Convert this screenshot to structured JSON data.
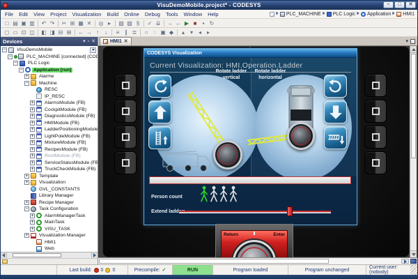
{
  "window": {
    "title": "VisuDemoMobile.project* - CODESYS",
    "controls": [
      {
        "glyph": "–",
        "name": "minimize"
      },
      {
        "glyph": "□",
        "name": "maximize"
      },
      {
        "glyph": "✕",
        "name": "close"
      }
    ]
  },
  "menu": {
    "items": [
      "File",
      "Edit",
      "View",
      "Project",
      "Visualization",
      "Build",
      "Online",
      "Debug",
      "Tools",
      "Window",
      "Help"
    ]
  },
  "breadcrumb": {
    "items": [
      {
        "label": "",
        "icon": "page"
      },
      {
        "label": "PLC_MACHINE",
        "icon": "device"
      },
      {
        "label": "PLC Logic",
        "icon": "plclogic"
      },
      {
        "label": "Application",
        "icon": "app"
      },
      {
        "label": "HMI1",
        "icon": "visu"
      }
    ]
  },
  "toolbars": {
    "row1": [
      {
        "g": "□",
        "n": "new-project"
      },
      {
        "g": "▤",
        "n": "open-project"
      },
      {
        "g": "▣",
        "n": "save-project"
      },
      {
        "g": "▥",
        "n": "print"
      },
      {
        "sep": true
      },
      {
        "g": "↶",
        "n": "undo"
      },
      {
        "g": "↷",
        "n": "redo"
      },
      {
        "sep": true
      },
      {
        "g": "✂",
        "n": "cut"
      },
      {
        "g": "⊞",
        "n": "copy"
      },
      {
        "g": "▦",
        "n": "paste"
      },
      {
        "g": "✕",
        "n": "delete"
      },
      {
        "sep": true
      },
      {
        "g": "◎",
        "n": "find"
      },
      {
        "g": "▸",
        "n": "find-next"
      },
      {
        "sep": true
      },
      {
        "g": "▧",
        "n": "new-pou"
      },
      {
        "g": "▨",
        "n": "new-device"
      },
      {
        "g": "§",
        "n": "edit-code"
      },
      {
        "sep": true
      },
      {
        "g": "✓",
        "n": "precompile"
      },
      {
        "g": "⇊",
        "n": "download"
      },
      {
        "sep": true
      },
      {
        "g": "→",
        "n": "login"
      },
      {
        "g": "←",
        "n": "logout"
      },
      {
        "g": "▶",
        "n": "start",
        "c": "#2e7d32"
      },
      {
        "g": "■",
        "n": "stop",
        "c": "#8a3a3a"
      },
      {
        "g": "▪",
        "n": "breakpoint"
      },
      {
        "g": "↻",
        "n": "reset"
      }
    ],
    "row2": [
      {
        "g": "◻",
        "n": "select-tool"
      },
      {
        "g": "▭",
        "n": "frame-tool"
      },
      {
        "g": "⊡",
        "n": "insert-element"
      },
      {
        "g": "◫",
        "n": "split-view"
      },
      {
        "sep": true
      },
      {
        "g": "◧",
        "n": "align-left"
      },
      {
        "g": "◨",
        "n": "align-right"
      },
      {
        "g": "⊟",
        "n": "align-top"
      },
      {
        "g": "⊞",
        "n": "align-bottom"
      },
      {
        "sep": true
      },
      {
        "g": "←",
        "n": "nudge-left"
      },
      {
        "g": "→",
        "n": "nudge-right"
      },
      {
        "g": "↑",
        "n": "nudge-up"
      },
      {
        "g": "↓",
        "n": "nudge-down"
      },
      {
        "sep": true
      },
      {
        "g": "≡",
        "n": "distribute"
      },
      {
        "g": "∥",
        "n": "same-width"
      },
      {
        "g": "≣",
        "n": "same-height"
      },
      {
        "sep": true
      },
      {
        "g": "○",
        "n": "ellipse-tool"
      },
      {
        "g": "◌",
        "n": "polygon-tool"
      },
      {
        "g": "▣",
        "n": "rectangle-tool"
      },
      {
        "g": "◆",
        "n": "rotate-tool"
      },
      {
        "sep": true
      },
      {
        "g": "▴",
        "n": "bring-forward"
      },
      {
        "g": "▾",
        "n": "send-backward"
      },
      {
        "g": "◂",
        "n": "group"
      },
      {
        "g": "▸",
        "n": "ungroup"
      }
    ]
  },
  "devices_panel": {
    "title": "Devices",
    "header_buttons": [
      {
        "glyph": "▾",
        "name": "panel-dropdown"
      },
      {
        "glyph": "▫",
        "name": "panel-pin"
      },
      {
        "glyph": "✕",
        "name": "panel-close"
      }
    ],
    "tree": [
      {
        "label": "VisuDemoMobile",
        "depth": 0,
        "icon": "project",
        "expand": "-",
        "italic": true,
        "combo": true
      },
      {
        "label": "PLC_MACHINE [connected] (CODESYS C",
        "depth": 1,
        "icon": "device",
        "expand": "-",
        "connected": true
      },
      {
        "label": "PLC Logic",
        "depth": 2,
        "icon": "plclogic",
        "expand": "-"
      },
      {
        "label": "Application [run]",
        "depth": 3,
        "icon": "app",
        "expand": "-",
        "highlight": true,
        "bold": true
      },
      {
        "label": "Alarme",
        "depth": 4,
        "icon": "folder",
        "expand": "+"
      },
      {
        "label": "Machine",
        "depth": 4,
        "icon": "folder",
        "expand": "-"
      },
      {
        "label": "RESC",
        "depth": 5,
        "icon": "resc"
      },
      {
        "label": "IP_RESC",
        "depth": 5,
        "icon": "ipresc"
      },
      {
        "label": "AlarmsModule (FB)",
        "depth": 5,
        "icon": "pou",
        "expand": "+"
      },
      {
        "label": "CockpitModule (FB)",
        "depth": 5,
        "icon": "pou",
        "expand": "+"
      },
      {
        "label": "DiagnosticsModule (FB)",
        "depth": 5,
        "icon": "pou",
        "expand": "+"
      },
      {
        "label": "HMIModule (FB)",
        "depth": 5,
        "icon": "pou",
        "expand": "+"
      },
      {
        "label": "LadderPositioningModule (FB)",
        "depth": 5,
        "icon": "pou",
        "expand": "+"
      },
      {
        "label": "LightPoleModule (FB)",
        "depth": 5,
        "icon": "pou",
        "expand": "+"
      },
      {
        "label": "MixtureModule (FB)",
        "depth": 5,
        "icon": "pou",
        "expand": "+"
      },
      {
        "label": "RecipesModule (FB)",
        "depth": 5,
        "icon": "pou",
        "expand": "+"
      },
      {
        "label": "RootModule (FB)",
        "depth": 5,
        "icon": "pou",
        "expand": "+",
        "dim": true
      },
      {
        "label": "ServiceStatusModule (FB)",
        "depth": 5,
        "icon": "pou",
        "expand": "+"
      },
      {
        "label": "TruckCheckModule (FB)",
        "depth": 5,
        "icon": "pou",
        "expand": "+"
      },
      {
        "label": "Template",
        "depth": 4,
        "icon": "folder",
        "expand": "+"
      },
      {
        "label": "Visualization",
        "depth": 4,
        "icon": "folder",
        "expand": "+"
      },
      {
        "label": "GVL_CONSTANTS",
        "depth": 4,
        "icon": "gvl"
      },
      {
        "label": "Library Manager",
        "depth": 4,
        "icon": "lib"
      },
      {
        "label": "Recipe Manager",
        "depth": 4,
        "icon": "recipe",
        "expand": "+"
      },
      {
        "label": "Task Configuration",
        "depth": 4,
        "icon": "taskcfg",
        "expand": "-"
      },
      {
        "label": "AlarmManagerTask",
        "depth": 5,
        "icon": "task",
        "expand": "+"
      },
      {
        "label": "MainTask",
        "depth": 5,
        "icon": "task",
        "expand": "+"
      },
      {
        "label": "VISU_TASK",
        "depth": 5,
        "icon": "task",
        "expand": "+"
      },
      {
        "label": "Visualization Manager",
        "depth": 4,
        "icon": "vm",
        "expand": "+"
      },
      {
        "label": "HMI1",
        "depth": 5,
        "icon": "visu"
      },
      {
        "label": "Web",
        "depth": 5,
        "icon": "web"
      }
    ]
  },
  "editor": {
    "tab_label": "HMI1",
    "tab_close": "✕",
    "dropdown": "▾"
  },
  "viz": {
    "window_title": "CODESYS Visualization",
    "heading": "Current Visualization: HMI.Operation.Ladder",
    "left_panel": {
      "label": "Rotate ladder vertical",
      "buttons": [
        "rotate-ccw",
        "arrow-up",
        "ladder-up"
      ]
    },
    "right_panel": {
      "label": "Rotate ladder horizontal",
      "buttons": [
        "rotate-cw",
        "arrow-down",
        "ladder-down"
      ]
    },
    "person_label": "Person count",
    "person_count": {
      "total": 4,
      "active": 1
    },
    "extend_label": "Extend ladder:",
    "extend_slider_pct": 73,
    "knob": {
      "left_label": "Return",
      "right_label": "Enter"
    }
  },
  "status": {
    "last_build_label": "Last build:",
    "errors": "0",
    "warnings": "0",
    "precompile_label": "Precompile:",
    "precompile_ok": "✓",
    "run_state": "RUN",
    "program_loaded": "Program loaded",
    "program_unchanged": "Program unchanged",
    "current_user": "Current user: (nobody)"
  },
  "colors": {
    "person_green": "#2dd62d",
    "person_inactive": "#e0e0e0",
    "ladder_yellow": "#e4ee3c",
    "slider_red": "#d42a2a",
    "run_green": "#8ee08e",
    "selection_green": "#6ae26a",
    "viz_screen_blue": "#0d2c4a",
    "viz_button_teal": "#2f7fb0",
    "knob_red": "#d02020"
  }
}
